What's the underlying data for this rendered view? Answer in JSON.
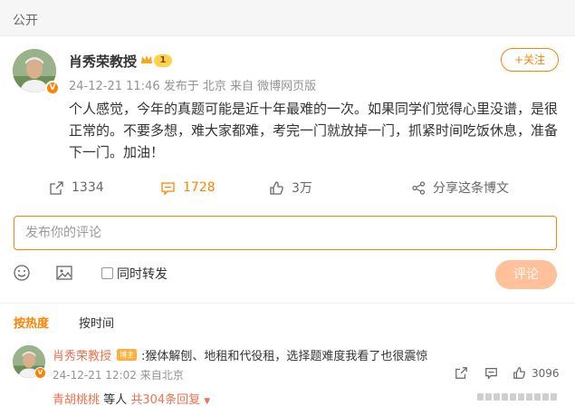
{
  "visibility_label": "公开",
  "post": {
    "author": "肖秀荣教授",
    "level": "1",
    "verified_mark": "V",
    "timestamp": "24-12-21 11:46",
    "location": "发布于 北京",
    "source": "来自 微博网页版",
    "follow_label": "+关注",
    "content": "个人感觉，今年的真题可能是近十年最难的一次。如果同学们觉得心里没谱，是很正常的。不要多想，难大家都难，考完一门就放掉一门，抓紧时间吃饭休息，准备下一门。加油！"
  },
  "actions": {
    "repost_count": "1334",
    "comment_count": "1728",
    "like_count": "3万",
    "share_label": "分享这条博文"
  },
  "comment_form": {
    "placeholder": "发布你的评论",
    "repost_label": "同时转发",
    "submit_label": "评论"
  },
  "sort_tabs": {
    "hot": "按热度",
    "time": "按时间"
  },
  "comment": {
    "author": "肖秀荣教授",
    "badge": "博主",
    "text": ":猴体解刨、地租和代役租，选择题难度我看了也很震惊",
    "timestamp": "24-12-21 12:02",
    "location": "来自北京",
    "like_count": "3096",
    "verified_mark": "V",
    "reply_user": "青胡桃桃",
    "reply_suffix": "等人",
    "reply_total": "共304条回复"
  },
  "colors": {
    "accent": "#ff8200",
    "username_link": "#eb7350",
    "submit_disabled": "#ffc09a"
  }
}
